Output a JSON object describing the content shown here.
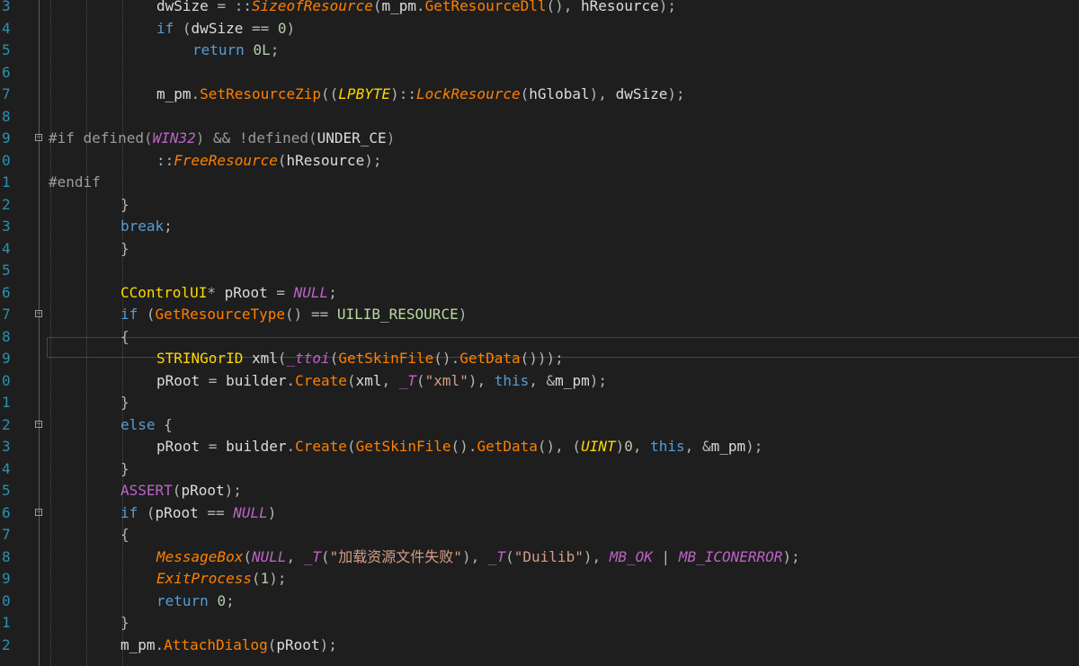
{
  "editor": {
    "line_numbers": [
      "3",
      "4",
      "5",
      "6",
      "7",
      "8",
      "9",
      "0",
      "1",
      "2",
      "3",
      "4",
      "5",
      "6",
      "7",
      "8",
      "9",
      "0",
      "1",
      "2",
      "3",
      "4",
      "5",
      "6",
      "7",
      "8",
      "9",
      "0",
      "1",
      "2"
    ],
    "lines": [
      {
        "indent": 3,
        "tokens": [
          [
            "id",
            "dwSize "
          ],
          [
            "op",
            "= ::"
          ],
          [
            "fni",
            "SizeofResource"
          ],
          [
            "op",
            "("
          ],
          [
            "id",
            "m_pm"
          ],
          [
            "op",
            "."
          ],
          [
            "fn",
            "GetResourceDll"
          ],
          [
            "op",
            "(), "
          ],
          [
            "id",
            "hResource"
          ],
          [
            "op",
            ");"
          ]
        ]
      },
      {
        "indent": 3,
        "tokens": [
          [
            "kw",
            "if "
          ],
          [
            "op",
            "("
          ],
          [
            "id",
            "dwSize "
          ],
          [
            "op",
            "== "
          ],
          [
            "nu",
            "0"
          ],
          [
            "op",
            ")"
          ]
        ]
      },
      {
        "indent": 4,
        "tokens": [
          [
            "kw",
            "return "
          ],
          [
            "nu",
            "0L"
          ],
          [
            "op",
            ";"
          ]
        ]
      },
      {
        "indent": 0,
        "tokens": []
      },
      {
        "indent": 3,
        "tokens": [
          [
            "id",
            "m_pm"
          ],
          [
            "op",
            "."
          ],
          [
            "fn",
            "SetResourceZip"
          ],
          [
            "op",
            "(("
          ],
          [
            "tyi",
            "LPBYTE"
          ],
          [
            "op",
            ")::"
          ],
          [
            "fni",
            "LockResource"
          ],
          [
            "op",
            "("
          ],
          [
            "id",
            "hGlobal"
          ],
          [
            "op",
            "), "
          ],
          [
            "id",
            "dwSize"
          ],
          [
            "op",
            ");"
          ]
        ]
      },
      {
        "indent": 0,
        "tokens": []
      },
      {
        "indent": 0,
        "fold": true,
        "tokens": [
          [
            "pp",
            "#if defined("
          ],
          [
            "mac",
            "WIN32"
          ],
          [
            "pp",
            ") && !defined("
          ],
          [
            "id",
            "UNDER_CE"
          ],
          [
            "pp",
            ")"
          ]
        ]
      },
      {
        "indent": 3,
        "tokens": [
          [
            "op",
            "::"
          ],
          [
            "fni",
            "FreeResource"
          ],
          [
            "op",
            "("
          ],
          [
            "id",
            "hResource"
          ],
          [
            "op",
            ");"
          ]
        ]
      },
      {
        "indent": 0,
        "tokens": [
          [
            "pp",
            "#endif"
          ]
        ]
      },
      {
        "indent": 2,
        "tokens": [
          [
            "op",
            "}"
          ]
        ]
      },
      {
        "indent": 2,
        "tokens": [
          [
            "kw",
            "break"
          ],
          [
            "op",
            ";"
          ]
        ]
      },
      {
        "indent": 2,
        "tokens": [
          [
            "op",
            "}"
          ]
        ]
      },
      {
        "indent": 0,
        "tokens": []
      },
      {
        "indent": 2,
        "tokens": [
          [
            "ty",
            "CControlUI"
          ],
          [
            "op",
            "* "
          ],
          [
            "id",
            "pRoot "
          ],
          [
            "op",
            "= "
          ],
          [
            "mac",
            "NULL"
          ],
          [
            "op",
            ";"
          ]
        ]
      },
      {
        "indent": 2,
        "fold": true,
        "tokens": [
          [
            "kw",
            "if "
          ],
          [
            "op",
            "("
          ],
          [
            "fn",
            "GetResourceType"
          ],
          [
            "op",
            "() == "
          ],
          [
            "en",
            "UILIB_RESOURCE"
          ],
          [
            "op",
            ")"
          ]
        ]
      },
      {
        "indent": 2,
        "tokens": [
          [
            "op",
            "{"
          ]
        ]
      },
      {
        "indent": 3,
        "tokens": [
          [
            "ty",
            "STRINGorID "
          ],
          [
            "id",
            "xml"
          ],
          [
            "op",
            "("
          ],
          [
            "mac",
            "_ttoi"
          ],
          [
            "op",
            "("
          ],
          [
            "fn",
            "GetSkinFile"
          ],
          [
            "op",
            "()."
          ],
          [
            "fn",
            "GetData"
          ],
          [
            "op",
            "()));"
          ]
        ]
      },
      {
        "indent": 3,
        "tokens": [
          [
            "id",
            "pRoot "
          ],
          [
            "op",
            "= "
          ],
          [
            "id",
            "builder"
          ],
          [
            "op",
            "."
          ],
          [
            "fn",
            "Create"
          ],
          [
            "op",
            "("
          ],
          [
            "id",
            "xml"
          ],
          [
            "op",
            ", "
          ],
          [
            "mac",
            "_T"
          ],
          [
            "op",
            "("
          ],
          [
            "str",
            "\"xml\""
          ],
          [
            "op",
            "), "
          ],
          [
            "kw",
            "this"
          ],
          [
            "op",
            ", &"
          ],
          [
            "id",
            "m_pm"
          ],
          [
            "op",
            ");"
          ]
        ]
      },
      {
        "indent": 2,
        "tokens": [
          [
            "op",
            "}"
          ]
        ]
      },
      {
        "indent": 2,
        "fold": true,
        "tokens": [
          [
            "kw",
            "else "
          ],
          [
            "op",
            "{"
          ]
        ]
      },
      {
        "indent": 3,
        "tokens": [
          [
            "id",
            "pRoot "
          ],
          [
            "op",
            "= "
          ],
          [
            "id",
            "builder"
          ],
          [
            "op",
            "."
          ],
          [
            "fn",
            "Create"
          ],
          [
            "op",
            "("
          ],
          [
            "fn",
            "GetSkinFile"
          ],
          [
            "op",
            "()."
          ],
          [
            "fn",
            "GetData"
          ],
          [
            "op",
            "(), ("
          ],
          [
            "tyi",
            "UINT"
          ],
          [
            "op",
            ")"
          ],
          [
            "nu",
            "0"
          ],
          [
            "op",
            ", "
          ],
          [
            "kw",
            "this"
          ],
          [
            "op",
            ", &"
          ],
          [
            "id",
            "m_pm"
          ],
          [
            "op",
            ");"
          ]
        ]
      },
      {
        "indent": 2,
        "tokens": [
          [
            "op",
            "}"
          ]
        ]
      },
      {
        "indent": 2,
        "tokens": [
          [
            "macn",
            "ASSERT"
          ],
          [
            "op",
            "("
          ],
          [
            "id",
            "pRoot"
          ],
          [
            "op",
            ");"
          ]
        ]
      },
      {
        "indent": 2,
        "fold": true,
        "tokens": [
          [
            "kw",
            "if "
          ],
          [
            "op",
            "("
          ],
          [
            "id",
            "pRoot "
          ],
          [
            "op",
            "== "
          ],
          [
            "mac",
            "NULL"
          ],
          [
            "op",
            ")"
          ]
        ]
      },
      {
        "indent": 2,
        "tokens": [
          [
            "op",
            "{"
          ]
        ]
      },
      {
        "indent": 3,
        "tokens": [
          [
            "fni",
            "MessageBox"
          ],
          [
            "op",
            "("
          ],
          [
            "mac",
            "NULL"
          ],
          [
            "op",
            ", "
          ],
          [
            "mac",
            "_T"
          ],
          [
            "op",
            "("
          ],
          [
            "str",
            "\"加载资源文件失败\""
          ],
          [
            "op",
            "), "
          ],
          [
            "mac",
            "_T"
          ],
          [
            "op",
            "("
          ],
          [
            "str",
            "\"Duilib\""
          ],
          [
            "op",
            "), "
          ],
          [
            "mac",
            "MB_OK"
          ],
          [
            "op",
            " | "
          ],
          [
            "mac",
            "MB_ICONERROR"
          ],
          [
            "op",
            ");"
          ]
        ]
      },
      {
        "indent": 3,
        "tokens": [
          [
            "fni",
            "ExitProcess"
          ],
          [
            "op",
            "("
          ],
          [
            "nu",
            "1"
          ],
          [
            "op",
            ");"
          ]
        ]
      },
      {
        "indent": 3,
        "tokens": [
          [
            "kw",
            "return "
          ],
          [
            "nu",
            "0"
          ],
          [
            "op",
            ";"
          ]
        ]
      },
      {
        "indent": 2,
        "tokens": [
          [
            "op",
            "}"
          ]
        ]
      },
      {
        "indent": 2,
        "tokens": [
          [
            "id",
            "m_pm"
          ],
          [
            "op",
            "."
          ],
          [
            "fn",
            "AttachDialog"
          ],
          [
            "op",
            "("
          ],
          [
            "id",
            "pRoot"
          ],
          [
            "op",
            ");"
          ]
        ]
      }
    ]
  }
}
